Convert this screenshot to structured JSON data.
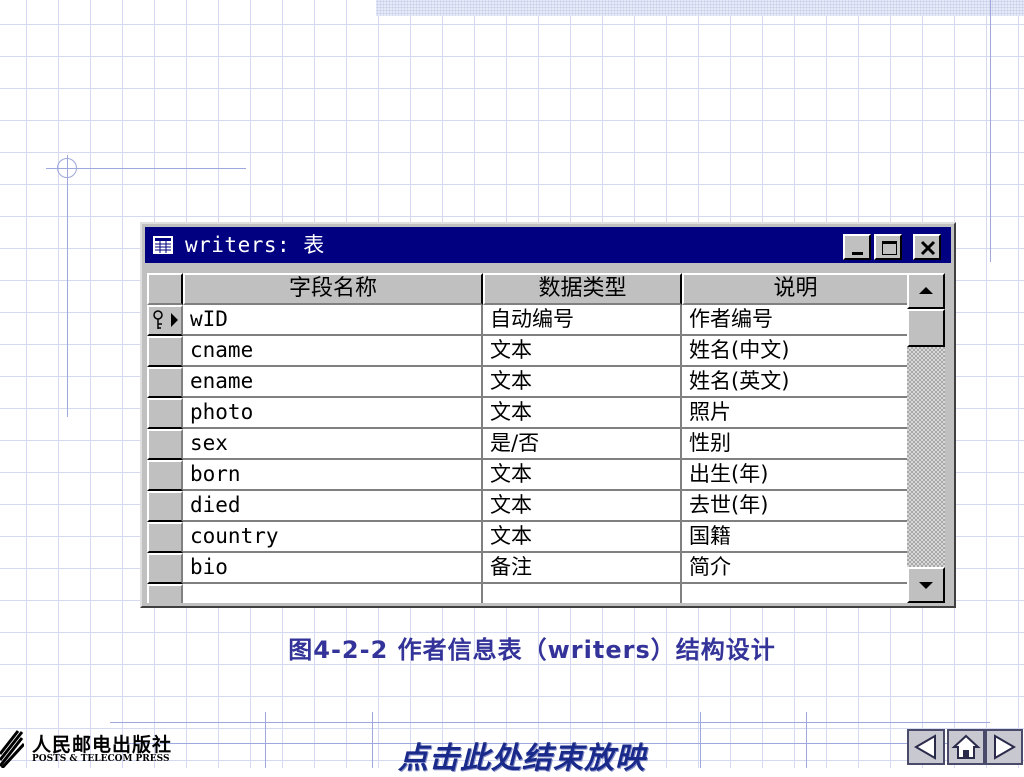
{
  "window": {
    "title": "writers: 表"
  },
  "table": {
    "headers": [
      "字段名称",
      "数据类型",
      "说明"
    ],
    "rows": [
      {
        "field": "wID",
        "type": "自动编号",
        "desc": "作者编号"
      },
      {
        "field": "cname",
        "type": "文本",
        "desc": "姓名(中文)"
      },
      {
        "field": "ename",
        "type": "文本",
        "desc": "姓名(英文)"
      },
      {
        "field": "photo",
        "type": "文本",
        "desc": "照片"
      },
      {
        "field": "sex",
        "type": "是/否",
        "desc": "性别"
      },
      {
        "field": "born",
        "type": "文本",
        "desc": "出生(年)"
      },
      {
        "field": "died",
        "type": "文本",
        "desc": "去世(年)"
      },
      {
        "field": "country",
        "type": "文本",
        "desc": "国籍"
      },
      {
        "field": "bio",
        "type": "备注",
        "desc": "简介"
      },
      {
        "field": "",
        "type": "",
        "desc": ""
      }
    ]
  },
  "caption": "图4-2-2  作者信息表（writers）结构设计",
  "footer": {
    "publisher_cn": "人民邮电出版社",
    "publisher_en": "POSTS & TELECOM PRESS",
    "end_show": "点击此处结束放映"
  },
  "icons": {
    "window": "table-icon",
    "minimize": "minimize-icon",
    "maximize": "maximize-icon",
    "close": "close-icon",
    "row_key": "primary-key-icon",
    "scroll_up": "arrow-up-icon",
    "scroll_down": "arrow-down-icon",
    "nav_prev": "triangle-left-icon",
    "nav_home": "home-icon",
    "nav_next": "triangle-right-icon"
  },
  "colors": {
    "titlebar": "#000080",
    "caption": "#333399",
    "end_show": "#1a2a8a"
  }
}
